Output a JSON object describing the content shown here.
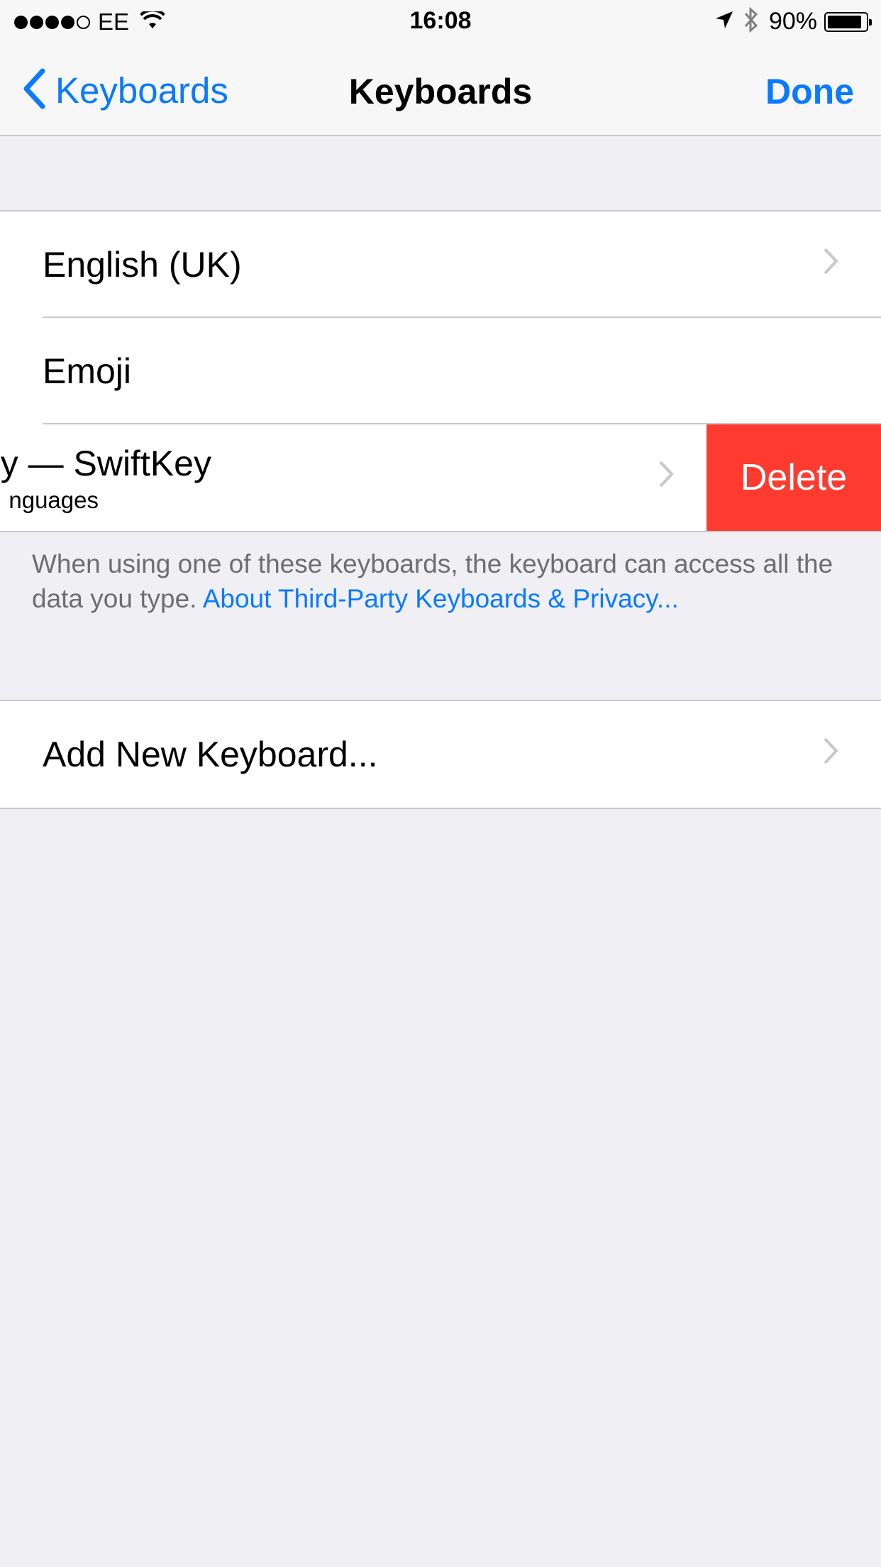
{
  "status_bar": {
    "carrier": "EE",
    "signal_bars": 4,
    "signal_total": 5,
    "time": "16:08",
    "battery_text": "90%",
    "battery_level": 0.9,
    "icons": [
      "signal-dots-icon",
      "wifi-icon",
      "location-arrow-icon",
      "bluetooth-icon",
      "battery-icon"
    ]
  },
  "nav": {
    "back_label": "Keyboards",
    "title": "Keyboards",
    "done_label": "Done"
  },
  "keyboards": [
    {
      "label": "English (UK)",
      "has_chevron": true
    },
    {
      "label": "Emoji",
      "has_chevron": false
    },
    {
      "label": "y — SwiftKey",
      "sublabel": "nguages",
      "has_chevron": true,
      "swiped": true
    }
  ],
  "delete_label": "Delete",
  "footer": {
    "text": "When using one of these keyboards, the keyboard can access all the data you type. ",
    "link": "About Third-Party Keyboards & Privacy..."
  },
  "add_keyboard_label": "Add New Keyboard...",
  "colors": {
    "accent": "#0a7aff",
    "delete": "#ff3b30",
    "background": "#efeff4",
    "separator": "#c8c7cc"
  }
}
